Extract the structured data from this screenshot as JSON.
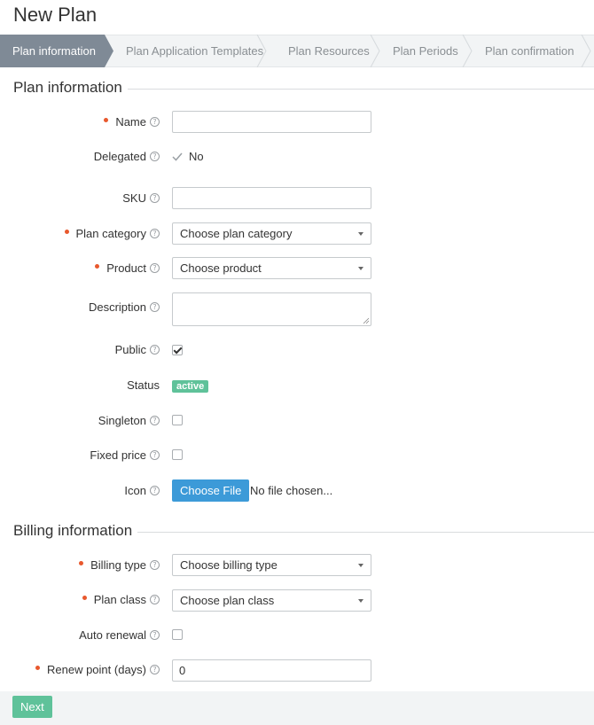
{
  "page": {
    "title": "New Plan"
  },
  "wizard": {
    "steps": [
      {
        "label": "Plan information",
        "active": true
      },
      {
        "label": "Plan Application Templates",
        "active": false
      },
      {
        "label": "Plan Resources",
        "active": false
      },
      {
        "label": "Plan Periods",
        "active": false
      },
      {
        "label": "Plan confirmation",
        "active": false
      }
    ]
  },
  "plan_info": {
    "title": "Plan information",
    "name": {
      "label": "Name",
      "value": ""
    },
    "delegated": {
      "label": "Delegated",
      "value": "No"
    },
    "sku": {
      "label": "SKU",
      "value": ""
    },
    "plan_category": {
      "label": "Plan category",
      "selected": "Choose plan category"
    },
    "product": {
      "label": "Product",
      "selected": "Choose product"
    },
    "description": {
      "label": "Description",
      "value": ""
    },
    "public": {
      "label": "Public",
      "checked": true
    },
    "status": {
      "label": "Status",
      "value": "active"
    },
    "singleton": {
      "label": "Singleton",
      "checked": false
    },
    "fixed_price": {
      "label": "Fixed price",
      "checked": false
    },
    "icon": {
      "label": "Icon",
      "button": "Choose File",
      "file_status": "No file chosen..."
    }
  },
  "billing_info": {
    "title": "Billing information",
    "billing_type": {
      "label": "Billing type",
      "selected": "Choose billing type"
    },
    "plan_class": {
      "label": "Plan class",
      "selected": "Choose plan class"
    },
    "auto_renewal": {
      "label": "Auto renewal",
      "checked": false
    },
    "renew_point": {
      "label": "Renew point (days)",
      "value": "0"
    }
  },
  "footer": {
    "next_label": "Next"
  },
  "colors": {
    "active_step": "#7f8a96",
    "required": "#e8582d",
    "primary": "#3c9ad8",
    "success": "#5fc29a"
  }
}
